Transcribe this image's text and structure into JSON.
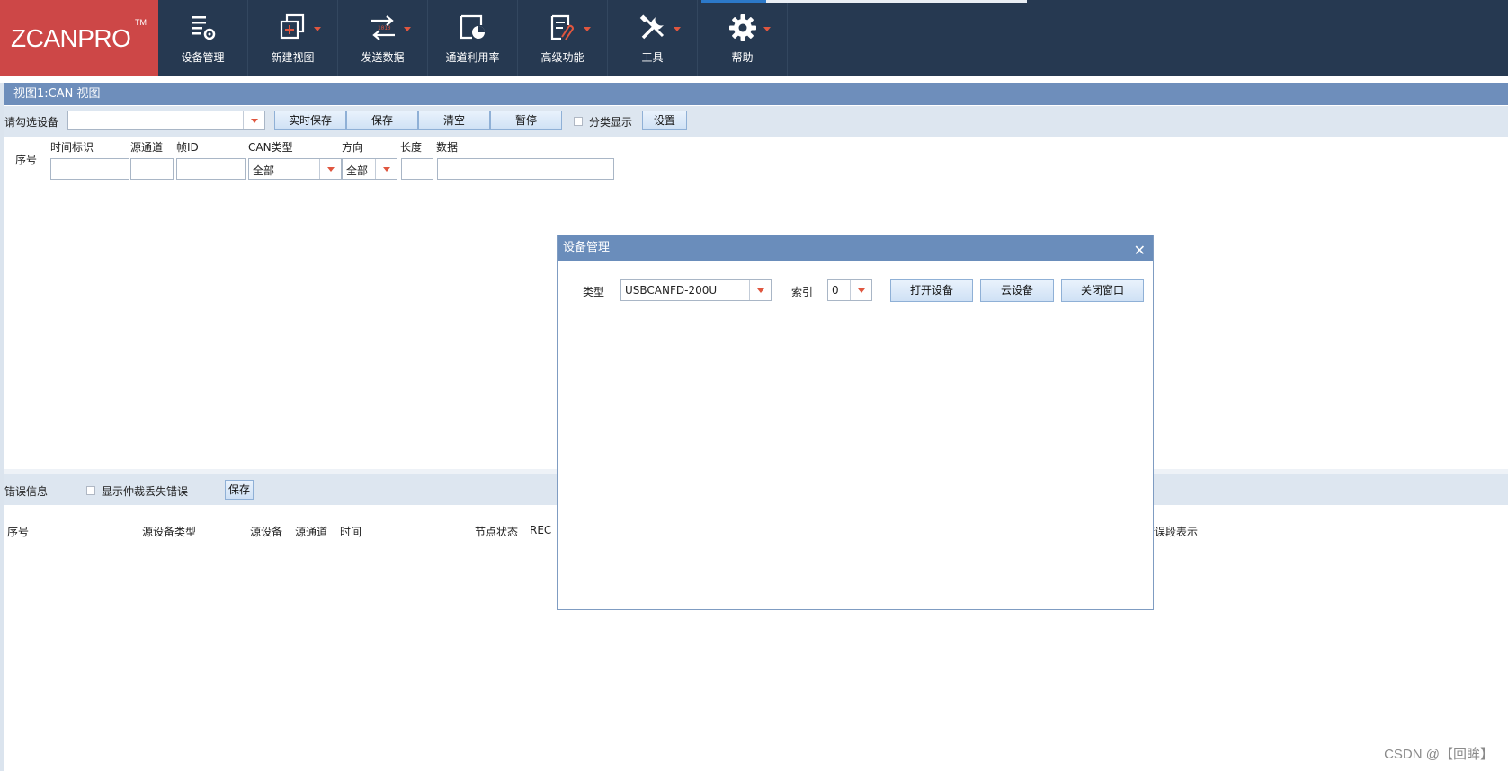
{
  "toolbar": {
    "logo": "ZCANPRO",
    "logo_tm": "TM",
    "items": [
      {
        "label": "设备管理",
        "icon": "device-manage-icon",
        "has_dropdown": false
      },
      {
        "label": "新建视图",
        "icon": "new-view-icon",
        "has_dropdown": true
      },
      {
        "label": "发送数据",
        "icon": "send-data-icon",
        "has_dropdown": true
      },
      {
        "label": "通道利用率",
        "icon": "channel-usage-icon",
        "has_dropdown": false
      },
      {
        "label": "高级功能",
        "icon": "advanced-icon",
        "has_dropdown": true
      },
      {
        "label": "工具",
        "icon": "tools-icon",
        "has_dropdown": true
      },
      {
        "label": "帮助",
        "icon": "gear-icon",
        "has_dropdown": true
      }
    ]
  },
  "view": {
    "title": "视图1:CAN 视图",
    "select_device_label": "请勾选设备",
    "select_device_value": "",
    "buttons": {
      "realtime_save": "实时保存",
      "save": "保存",
      "clear": "清空",
      "pause": "暂停",
      "settings": "设置"
    },
    "classify_label": "分类显示",
    "classify_checked": false
  },
  "columns": {
    "seq": "序号",
    "timestamp": "时间标识",
    "source_channel": "源通道",
    "frame_id": "帧ID",
    "can_type": "CAN类型",
    "direction": "方向",
    "length": "长度",
    "data": "数据",
    "can_type_value": "全部",
    "direction_value": "全部"
  },
  "errors": {
    "label": "错误信息",
    "show_arb_label": "显示仲裁丢失错误",
    "show_arb_checked": false,
    "save_label": "保存",
    "columns": {
      "seq": "序号",
      "source_device_type": "源设备类型",
      "source_device": "源设备",
      "source_channel": "源通道",
      "time": "时间",
      "node_state": "节点状态",
      "rec": "REC",
      "error_segment": "错误段表示"
    }
  },
  "dialog": {
    "title": "设备管理",
    "close": "✕",
    "type_label": "类型",
    "type_value": "USBCANFD-200U",
    "index_label": "索引",
    "index_value": "0",
    "open_device": "打开设备",
    "cloud_device": "云设备",
    "close_window": "关闭窗口"
  },
  "watermark": "CSDN @【回眸】",
  "colors": {
    "toolbar_bg": "#263951",
    "logo_bg": "#cd4747",
    "view_title_bg": "#6e8ebb",
    "filter_bar_bg": "#dde6f0",
    "caret": "#e0563f"
  }
}
